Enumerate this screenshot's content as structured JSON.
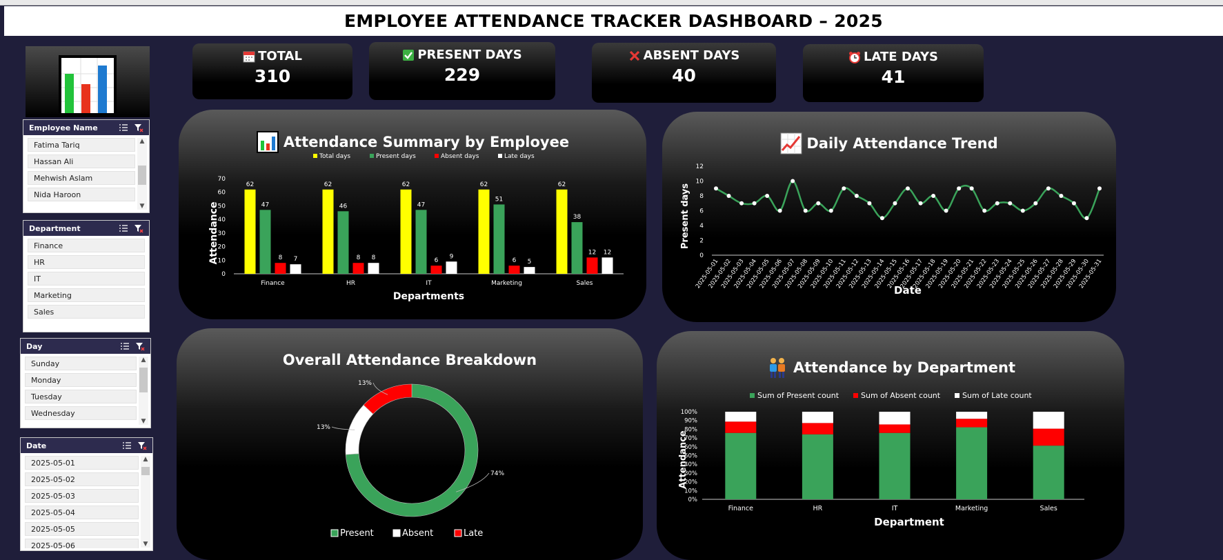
{
  "title": "EMPLOYEE ATTENDANCE TRACKER DASHBOARD – 2025",
  "kpis": {
    "total": {
      "label": "TOTAL",
      "value": "310",
      "icon": "calendar-icon"
    },
    "present": {
      "label": "PRESENT DAYS",
      "value": "229",
      "icon": "check-icon"
    },
    "absent": {
      "label": "ABSENT DAYS",
      "value": "40",
      "icon": "cross-icon"
    },
    "late": {
      "label": "LATE DAYS",
      "value": "41",
      "icon": "alarm-clock-icon"
    }
  },
  "slicers": {
    "employee": {
      "header": "Employee Name",
      "items": [
        "Fatima Tariq",
        "Hassan Ali",
        "Mehwish Aslam",
        "Nida Haroon"
      ]
    },
    "department": {
      "header": "Department",
      "items": [
        "Finance",
        "HR",
        "IT",
        "Marketing",
        "Sales"
      ]
    },
    "day": {
      "header": "Day",
      "items": [
        "Sunday",
        "Monday",
        "Tuesday",
        "Wednesday"
      ]
    },
    "date": {
      "header": "Date",
      "items": [
        "2025-05-01",
        "2025-05-02",
        "2025-05-03",
        "2025-05-04",
        "2025-05-05",
        "2025-05-06"
      ]
    }
  },
  "colors": {
    "background": "#1f1e3a",
    "total": "#ffff00",
    "present": "#3aa35a",
    "absent": "#ff0000",
    "late": "#ffffff",
    "slicer_header": "#2d2b4e"
  },
  "chart_data": [
    {
      "type": "bar",
      "title": "Attendance Summary by Employee",
      "xlabel": "Departments",
      "ylabel": "Attendance",
      "categories": [
        "Finance",
        "HR",
        "IT",
        "Marketing",
        "Sales"
      ],
      "series": [
        {
          "name": "Total days",
          "values": [
            62,
            62,
            62,
            62,
            62
          ]
        },
        {
          "name": "Present days",
          "values": [
            47,
            46,
            47,
            51,
            38
          ]
        },
        {
          "name": "Absent days",
          "values": [
            8,
            8,
            6,
            6,
            12
          ]
        },
        {
          "name": "Late days",
          "values": [
            7,
            8,
            9,
            5,
            12
          ]
        }
      ],
      "ylim": [
        0,
        70
      ],
      "yticks": [
        "0",
        "10",
        "20",
        "30",
        "40",
        "50",
        "60",
        "70"
      ],
      "legend": "top"
    },
    {
      "type": "line",
      "title": "Daily Attendance Trend",
      "xlabel": "Date",
      "ylabel": "Present days",
      "x": [
        "2025-05-01",
        "2025-05-02",
        "2025-05-03",
        "2025-05-04",
        "2025-05-05",
        "2025-05-06",
        "2025-05-07",
        "2025-05-08",
        "2025-05-09",
        "2025-05-10",
        "2025-05-11",
        "2025-05-12",
        "2025-05-13",
        "2025-05-14",
        "2025-05-15",
        "2025-05-16",
        "2025-05-17",
        "2025-05-18",
        "2025-05-19",
        "2025-05-20",
        "2025-05-21",
        "2025-05-22",
        "2025-05-23",
        "2025-05-24",
        "2025-05-25",
        "2025-05-26",
        "2025-05-27",
        "2025-05-28",
        "2025-05-29",
        "2025-05-30",
        "2025-05-31"
      ],
      "y": [
        9,
        8,
        7,
        7,
        8,
        6,
        10,
        6,
        7,
        6,
        9,
        8,
        7,
        5,
        7,
        9,
        7,
        8,
        6,
        9,
        9,
        6,
        7,
        7,
        6,
        7,
        9,
        8,
        7,
        5,
        9
      ],
      "ylim": [
        0,
        12
      ],
      "yticks": [
        "0",
        "2",
        "4",
        "6",
        "8",
        "10",
        "12"
      ]
    },
    {
      "type": "pie",
      "title": "Overall Attendance Breakdown",
      "categories": [
        "Present",
        "Absent",
        "Late"
      ],
      "values": [
        74,
        13,
        13
      ],
      "labels": [
        "74%",
        "13%",
        "13%"
      ],
      "legend": "bottom"
    },
    {
      "type": "bar",
      "stacked": "percent",
      "title": "Attendance by Department",
      "xlabel": "Department",
      "ylabel": "Attendance",
      "categories": [
        "Finance",
        "HR",
        "IT",
        "Marketing",
        "Sales"
      ],
      "series": [
        {
          "name": "Sum of Present count",
          "values": [
            47,
            46,
            47,
            51,
            38
          ]
        },
        {
          "name": "Sum of Absent count",
          "values": [
            8,
            8,
            6,
            6,
            12
          ]
        },
        {
          "name": "Sum of Late count",
          "values": [
            7,
            8,
            9,
            5,
            12
          ]
        }
      ],
      "yticks": [
        "0%",
        "10%",
        "20%",
        "30%",
        "40%",
        "50%",
        "60%",
        "70%",
        "80%",
        "90%",
        "100%"
      ],
      "legend": "top"
    }
  ]
}
